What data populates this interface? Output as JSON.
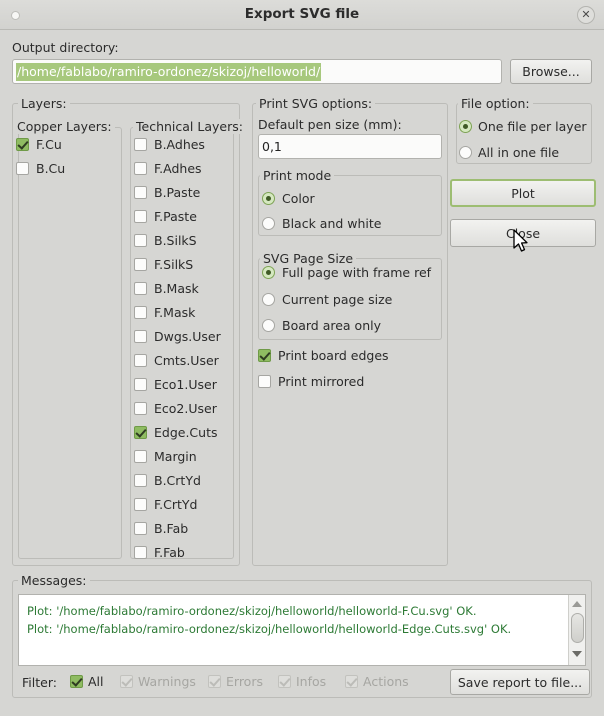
{
  "window": {
    "title": "Export SVG file",
    "close_icon": "close-icon",
    "menu_dot_icon": "window-menu-dot-icon"
  },
  "output": {
    "label": "Output directory:",
    "value": "/home/fablabo/ramiro-ordonez/skizoj/helloworld/",
    "browse_label": "Browse...",
    "selection_color": "#a7c87d"
  },
  "layers": {
    "title": "Layers:",
    "copper": {
      "title": "Copper Layers:",
      "items": [
        {
          "label": "F.Cu",
          "checked": true
        },
        {
          "label": "B.Cu",
          "checked": false
        }
      ]
    },
    "technical": {
      "title": "Technical Layers:",
      "items": [
        {
          "label": "B.Adhes",
          "checked": false
        },
        {
          "label": "F.Adhes",
          "checked": false
        },
        {
          "label": "B.Paste",
          "checked": false
        },
        {
          "label": "F.Paste",
          "checked": false
        },
        {
          "label": "B.SilkS",
          "checked": false
        },
        {
          "label": "F.SilkS",
          "checked": false
        },
        {
          "label": "B.Mask",
          "checked": false
        },
        {
          "label": "F.Mask",
          "checked": false
        },
        {
          "label": "Dwgs.User",
          "checked": false
        },
        {
          "label": "Cmts.User",
          "checked": false
        },
        {
          "label": "Eco1.User",
          "checked": false
        },
        {
          "label": "Eco2.User",
          "checked": false
        },
        {
          "label": "Edge.Cuts",
          "checked": true
        },
        {
          "label": "Margin",
          "checked": false
        },
        {
          "label": "B.CrtYd",
          "checked": false
        },
        {
          "label": "F.CrtYd",
          "checked": false
        },
        {
          "label": "B.Fab",
          "checked": false
        },
        {
          "label": "F.Fab",
          "checked": false
        }
      ]
    }
  },
  "print_options": {
    "title": "Print SVG options:",
    "pen_size_label": "Default pen size (mm):",
    "pen_size_value": "0,1",
    "print_mode": {
      "title": "Print mode",
      "options": [
        {
          "label": "Color",
          "selected": true
        },
        {
          "label": "Black and white",
          "selected": false
        }
      ]
    },
    "page_size": {
      "title": "SVG Page Size",
      "options": [
        {
          "label": "Full page with  frame ref",
          "selected": true
        },
        {
          "label": "Current page size",
          "selected": false
        },
        {
          "label": "Board area only",
          "selected": false
        }
      ]
    },
    "checkboxes": [
      {
        "label": "Print board edges",
        "checked": true
      },
      {
        "label": "Print mirrored",
        "checked": false
      }
    ]
  },
  "file_option": {
    "title": "File option:",
    "options": [
      {
        "label": "One file per layer",
        "selected": true
      },
      {
        "label": "All in one file",
        "selected": false
      }
    ]
  },
  "actions": {
    "plot_label": "Plot",
    "close_label": "Close",
    "default_border_color": "#9dbd72"
  },
  "messages": {
    "title": "Messages:",
    "lines": [
      "Plot: '/home/fablabo/ramiro-ordonez/skizoj/helloworld/helloworld-F.Cu.svg' OK.",
      "Plot: '/home/fablabo/ramiro-ordonez/skizoj/helloworld/helloworld-Edge.Cuts.svg' OK."
    ],
    "text_color": "#2d7a35"
  },
  "filter": {
    "label": "Filter:",
    "items": [
      {
        "label": "All",
        "checked": true,
        "disabled": false
      },
      {
        "label": "Warnings",
        "checked": true,
        "disabled": true
      },
      {
        "label": "Errors",
        "checked": true,
        "disabled": true
      },
      {
        "label": "Infos",
        "checked": true,
        "disabled": true
      },
      {
        "label": "Actions",
        "checked": true,
        "disabled": true
      }
    ],
    "save_report_label": "Save report to file..."
  }
}
